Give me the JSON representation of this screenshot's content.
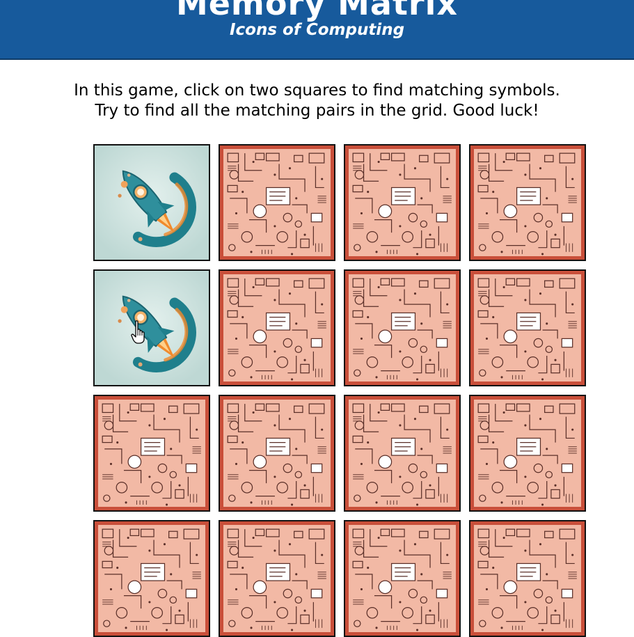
{
  "header": {
    "title": "Memory Matrix",
    "subtitle": "Icons of Computing"
  },
  "instructions": {
    "line1": "In this game, click on two squares to find matching symbols.",
    "line2": "Try to find all the matching pairs in the grid. Good luck!"
  },
  "grid": {
    "columns": 4,
    "cards": [
      {
        "state": "face-up",
        "icon": "rocket-icon"
      },
      {
        "state": "face-down",
        "icon": "circuit-pattern-icon"
      },
      {
        "state": "face-down",
        "icon": "circuit-pattern-icon"
      },
      {
        "state": "face-down",
        "icon": "circuit-pattern-icon"
      },
      {
        "state": "face-up",
        "icon": "rocket-icon"
      },
      {
        "state": "face-down",
        "icon": "circuit-pattern-icon"
      },
      {
        "state": "face-down",
        "icon": "circuit-pattern-icon"
      },
      {
        "state": "face-down",
        "icon": "circuit-pattern-icon"
      },
      {
        "state": "face-down",
        "icon": "circuit-pattern-icon"
      },
      {
        "state": "face-down",
        "icon": "circuit-pattern-icon"
      },
      {
        "state": "face-down",
        "icon": "circuit-pattern-icon"
      },
      {
        "state": "face-down",
        "icon": "circuit-pattern-icon"
      },
      {
        "state": "face-down",
        "icon": "circuit-pattern-icon"
      },
      {
        "state": "face-down",
        "icon": "circuit-pattern-icon"
      },
      {
        "state": "face-down",
        "icon": "circuit-pattern-icon"
      },
      {
        "state": "face-down",
        "icon": "circuit-pattern-icon"
      }
    ]
  },
  "colors": {
    "header_bg": "#175a9c",
    "card_back_border": "#c94f3a",
    "card_back_fill": "#f2b9a5",
    "rocket_body": "#2f8f9c",
    "rocket_flame": "#f08a2c"
  }
}
